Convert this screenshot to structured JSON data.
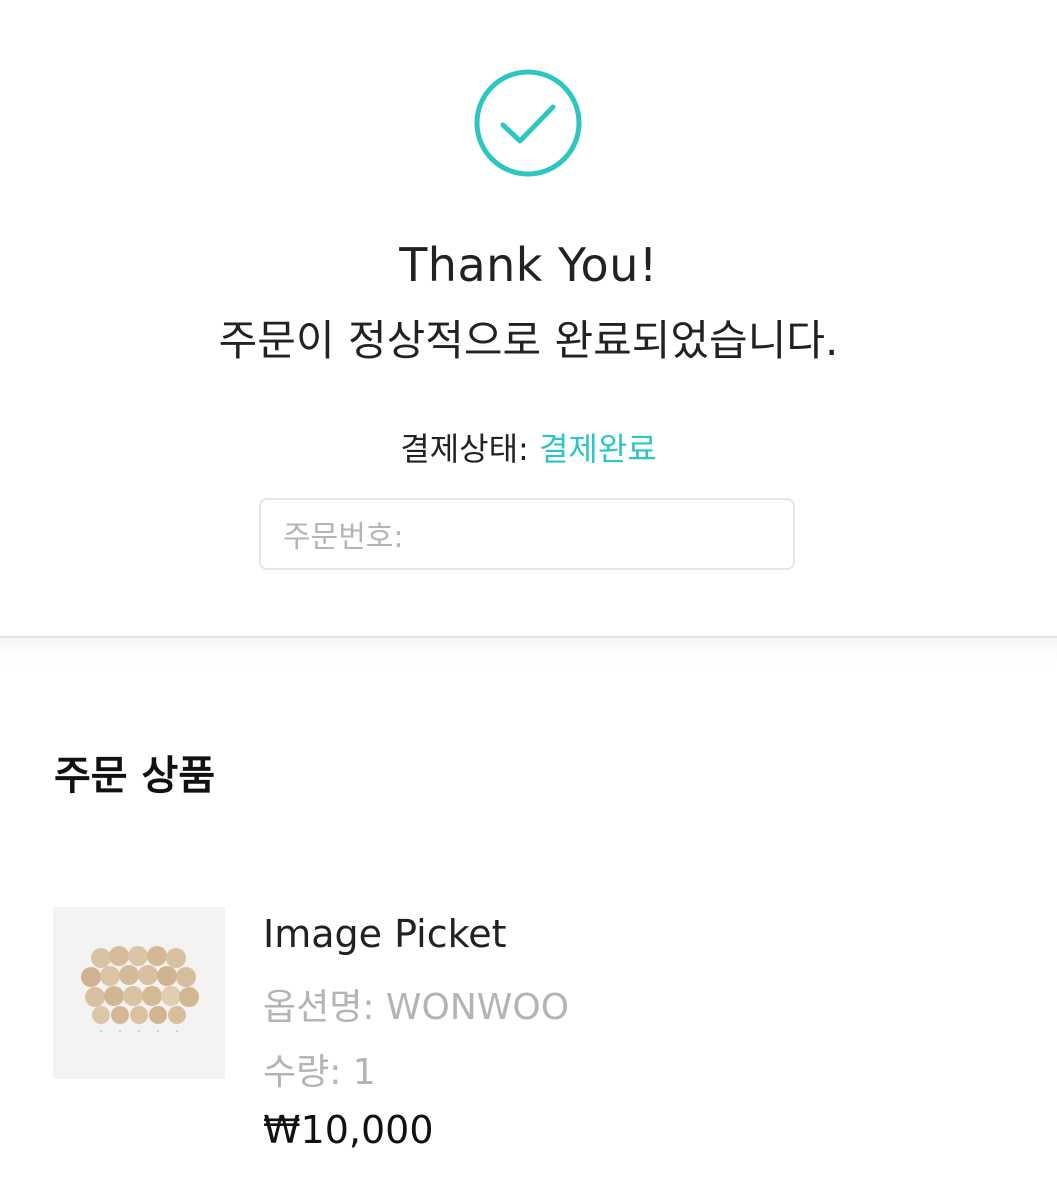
{
  "confirmation": {
    "icon": "check-circle-icon",
    "accent_color": "#2ec6c0",
    "title": "Thank You!",
    "message": "주문이 정상적으로 완료되었습니다.",
    "payment_status_label": "결제상태: ",
    "payment_status_value": "결제완료",
    "order_number_label": "주문번호:"
  },
  "order_items": {
    "heading": "주문 상품",
    "items": [
      {
        "thumbnail": "product-photo-image",
        "name": "Image Picket",
        "option": "옵션명: WONWOO",
        "quantity": "수량: 1",
        "price": "₩10,000"
      }
    ]
  }
}
